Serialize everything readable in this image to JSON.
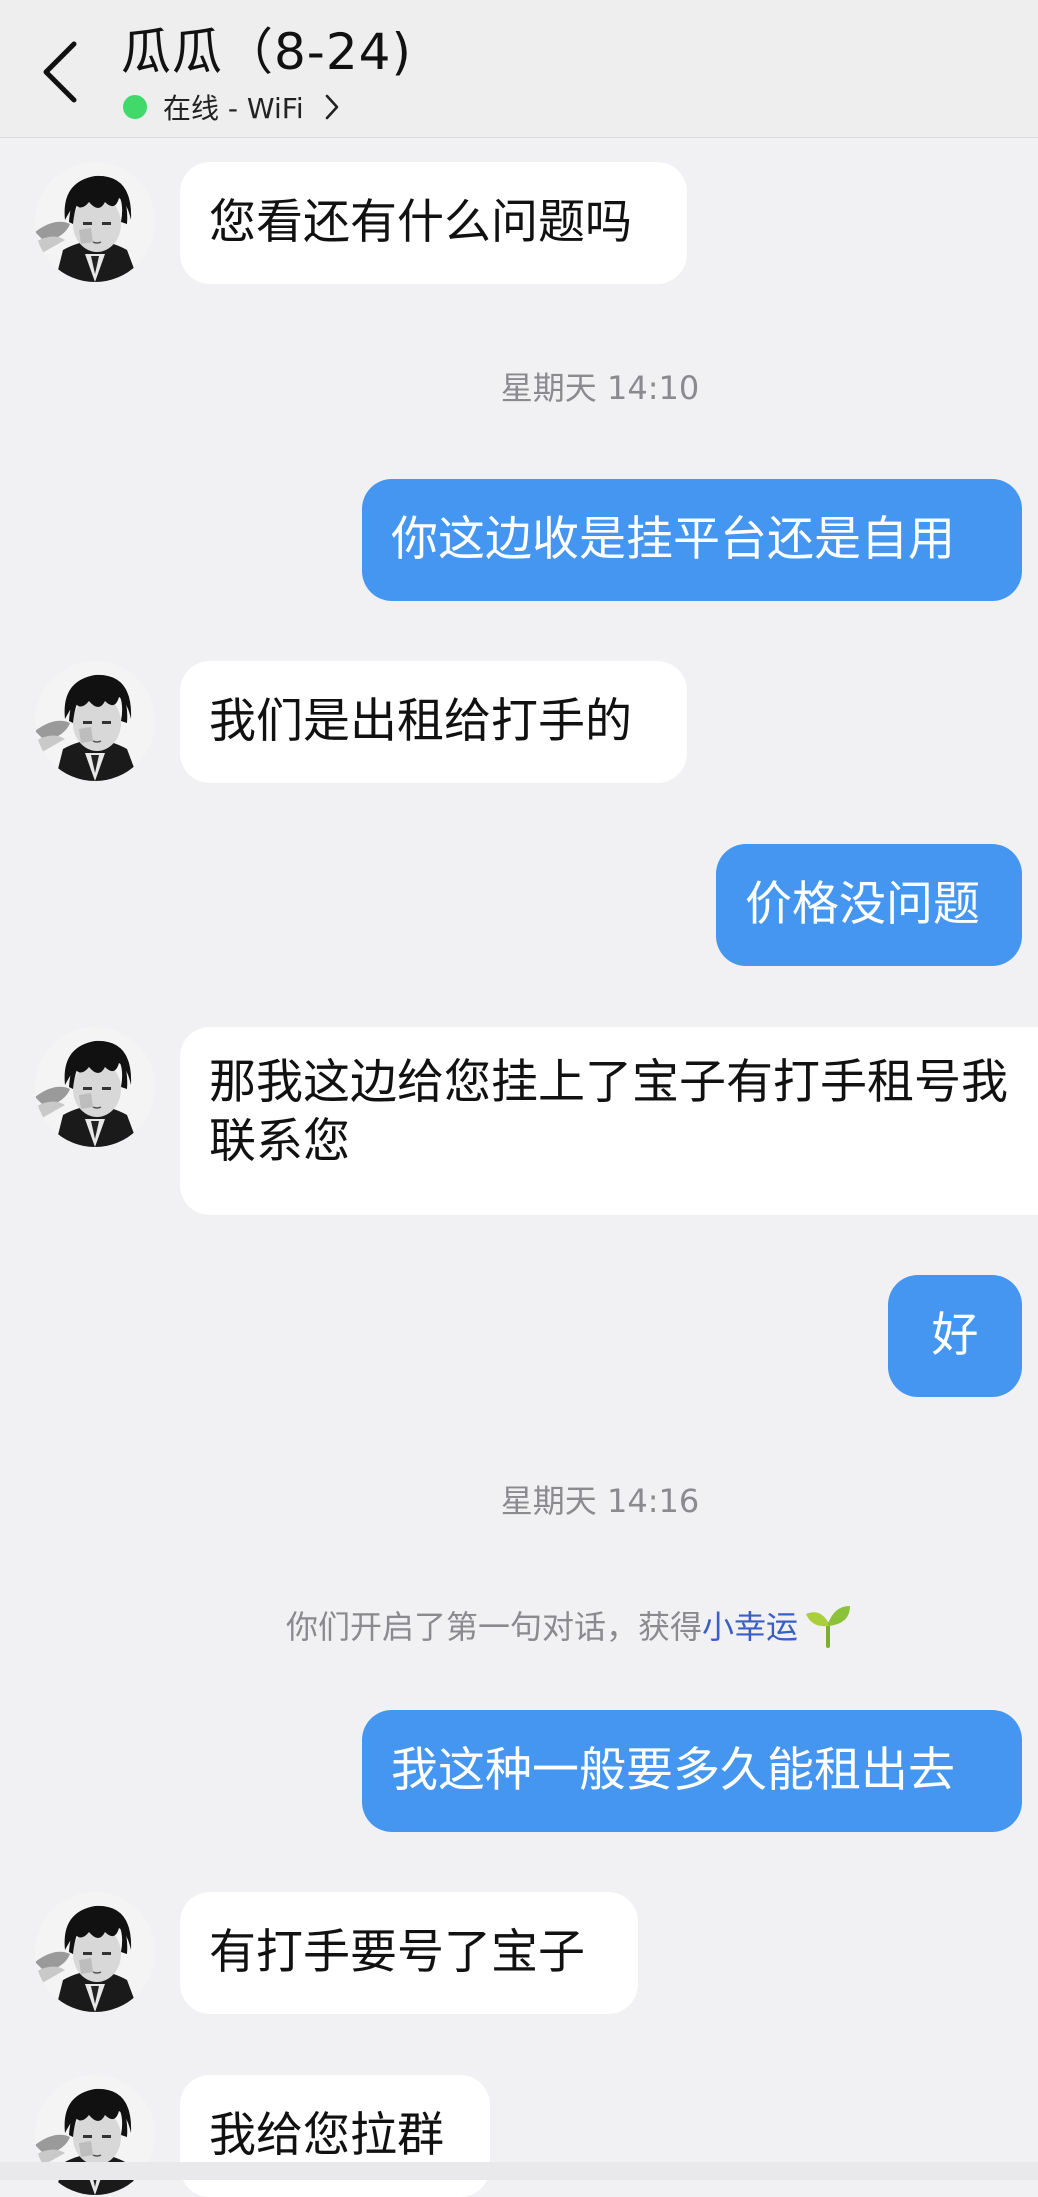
{
  "header": {
    "title": "瓜瓜（8-24)",
    "status": "在线 - WiFi",
    "back_icon": "chevron-left-icon",
    "status_chevron_icon": "chevron-right-icon",
    "status_color": "#42d96b"
  },
  "colors": {
    "outgoing_bubble": "#4496f0",
    "incoming_bubble": "#ffffff",
    "background": "#f1f1f3"
  },
  "messages": [
    {
      "side": "in",
      "text": "您看还有什么问题吗"
    },
    {
      "type": "timestamp",
      "text": "星期天 14:10"
    },
    {
      "side": "out",
      "text": "你这边收是挂平台还是自用"
    },
    {
      "side": "in",
      "text": "我们是出租给打手的"
    },
    {
      "side": "out",
      "text": "价格没问题"
    },
    {
      "side": "in",
      "text": "那我这边给您挂上了宝子有打手租号我联系您"
    },
    {
      "side": "out",
      "text": "好"
    },
    {
      "type": "timestamp",
      "text": "星期天 14:16"
    },
    {
      "type": "system",
      "text": "你们开启了第一句对话，获得",
      "link": "小幸运",
      "icon": "sprout-icon"
    },
    {
      "side": "out",
      "text": "我这种一般要多久能租出去"
    },
    {
      "side": "in",
      "text": "有打手要号了宝子"
    },
    {
      "side": "in",
      "text": "我给您拉群"
    }
  ]
}
